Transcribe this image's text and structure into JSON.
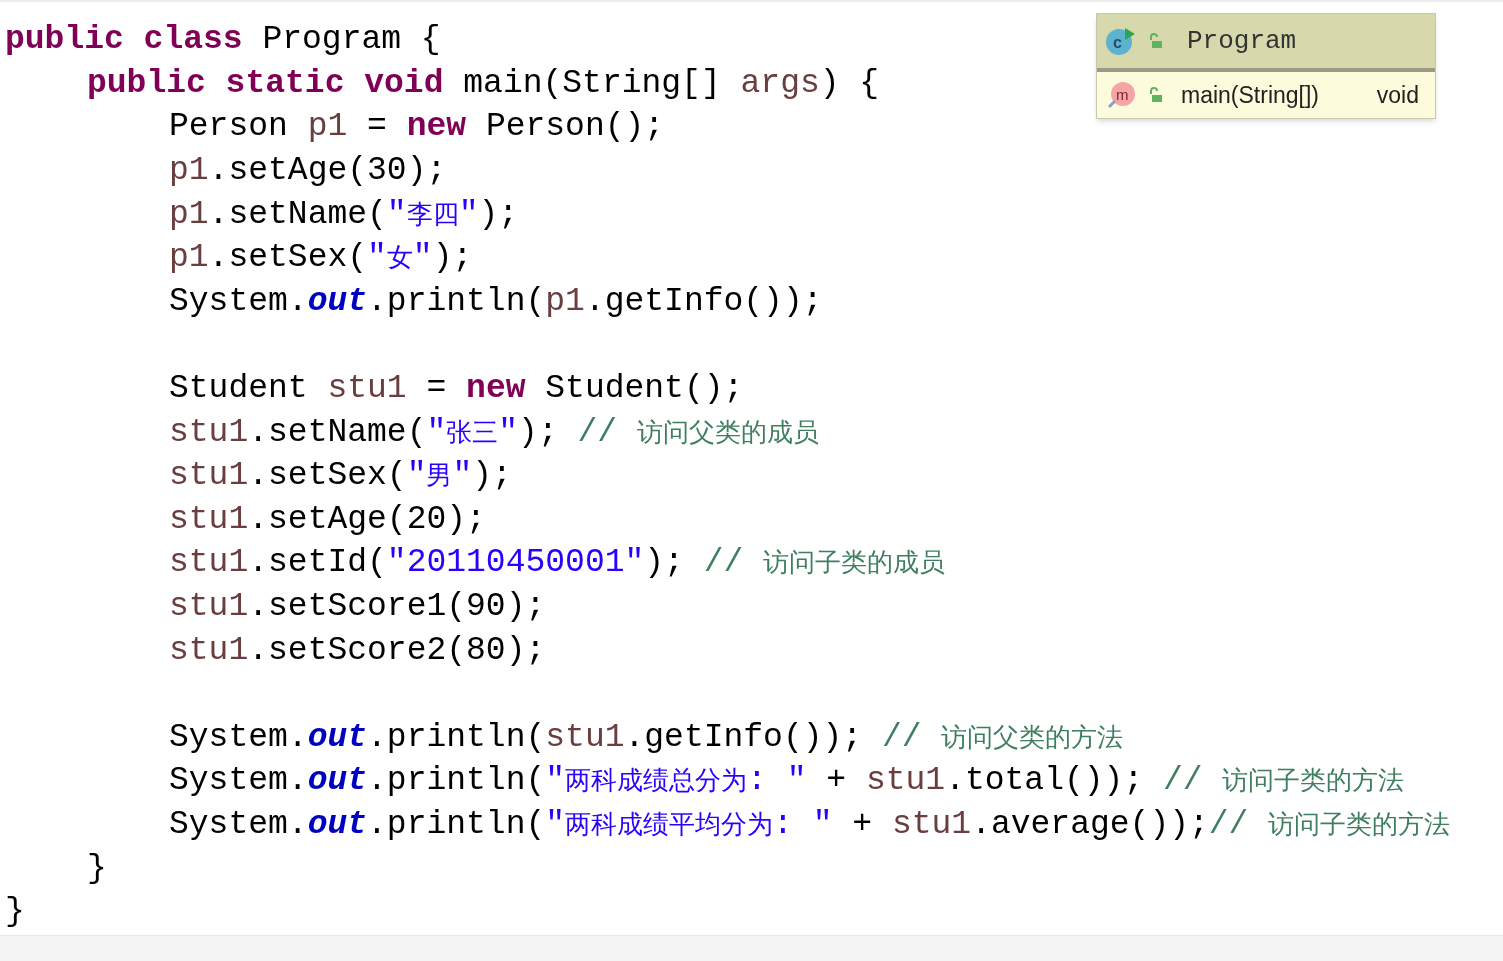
{
  "code": [
    {
      "kind": "code",
      "tokens": [
        {
          "kind": "kw",
          "text": "public class"
        },
        {
          "kind": "plain",
          "text": " Program {"
        }
      ],
      "children": [
        {
          "kind": "code",
          "tokens": [
            {
              "kind": "kw",
              "text": "public static void"
            },
            {
              "kind": "plain",
              "text": " main(String[] "
            },
            {
              "kind": "var",
              "text": "args"
            },
            {
              "kind": "plain",
              "text": ") {"
            }
          ],
          "children": [
            {
              "kind": "code",
              "tokens": [
                {
                  "kind": "plain",
                  "text": "Person "
                },
                {
                  "kind": "var",
                  "text": "p1"
                },
                {
                  "kind": "plain",
                  "text": " = "
                },
                {
                  "kind": "kw",
                  "text": "new"
                },
                {
                  "kind": "plain",
                  "text": " Person();"
                }
              ]
            },
            {
              "kind": "code",
              "tokens": [
                {
                  "kind": "var",
                  "text": "p1"
                },
                {
                  "kind": "plain",
                  "text": ".setAge(30);"
                }
              ]
            },
            {
              "kind": "code",
              "tokens": [
                {
                  "kind": "var",
                  "text": "p1"
                },
                {
                  "kind": "plain",
                  "text": ".setName("
                },
                {
                  "kind": "str",
                  "text": "\"李四\""
                },
                {
                  "kind": "plain",
                  "text": ");"
                }
              ]
            },
            {
              "kind": "code",
              "tokens": [
                {
                  "kind": "var",
                  "text": "p1"
                },
                {
                  "kind": "plain",
                  "text": ".setSex("
                },
                {
                  "kind": "str",
                  "text": "\"女\""
                },
                {
                  "kind": "plain",
                  "text": ");"
                }
              ]
            },
            {
              "kind": "code",
              "tokens": [
                {
                  "kind": "plain",
                  "text": "System."
                },
                {
                  "kind": "field",
                  "text": "out"
                },
                {
                  "kind": "plain",
                  "text": ".println("
                },
                {
                  "kind": "var",
                  "text": "p1"
                },
                {
                  "kind": "plain",
                  "text": ".getInfo());"
                }
              ]
            },
            {
              "kind": "blank"
            },
            {
              "kind": "code",
              "tokens": [
                {
                  "kind": "plain",
                  "text": "Student "
                },
                {
                  "kind": "var",
                  "text": "stu1"
                },
                {
                  "kind": "plain",
                  "text": " = "
                },
                {
                  "kind": "kw",
                  "text": "new"
                },
                {
                  "kind": "plain",
                  "text": " Student();"
                }
              ]
            },
            {
              "kind": "code",
              "tokens": [
                {
                  "kind": "var",
                  "text": "stu1"
                },
                {
                  "kind": "plain",
                  "text": ".setName("
                },
                {
                  "kind": "str",
                  "text": "\"张三\""
                },
                {
                  "kind": "plain",
                  "text": "); "
                },
                {
                  "kind": "com",
                  "text": "// 访问父类的成员"
                }
              ]
            },
            {
              "kind": "code",
              "tokens": [
                {
                  "kind": "var",
                  "text": "stu1"
                },
                {
                  "kind": "plain",
                  "text": ".setSex("
                },
                {
                  "kind": "str",
                  "text": "\"男\""
                },
                {
                  "kind": "plain",
                  "text": ");"
                }
              ]
            },
            {
              "kind": "code",
              "tokens": [
                {
                  "kind": "var",
                  "text": "stu1"
                },
                {
                  "kind": "plain",
                  "text": ".setAge(20);"
                }
              ]
            },
            {
              "kind": "code",
              "tokens": [
                {
                  "kind": "var",
                  "text": "stu1"
                },
                {
                  "kind": "plain",
                  "text": ".setId("
                },
                {
                  "kind": "str",
                  "text": "\"20110450001\""
                },
                {
                  "kind": "plain",
                  "text": "); "
                },
                {
                  "kind": "com",
                  "text": "// 访问子类的成员"
                }
              ]
            },
            {
              "kind": "code",
              "tokens": [
                {
                  "kind": "var",
                  "text": "stu1"
                },
                {
                  "kind": "plain",
                  "text": ".setScore1(90);"
                }
              ]
            },
            {
              "kind": "code",
              "tokens": [
                {
                  "kind": "var",
                  "text": "stu1"
                },
                {
                  "kind": "plain",
                  "text": ".setScore2(80);"
                }
              ]
            },
            {
              "kind": "blank"
            },
            {
              "kind": "code",
              "tokens": [
                {
                  "kind": "plain",
                  "text": "System."
                },
                {
                  "kind": "field",
                  "text": "out"
                },
                {
                  "kind": "plain",
                  "text": ".println("
                },
                {
                  "kind": "var",
                  "text": "stu1"
                },
                {
                  "kind": "plain",
                  "text": ".getInfo()); "
                },
                {
                  "kind": "com",
                  "text": "// 访问父类的方法"
                }
              ]
            },
            {
              "kind": "code",
              "tokens": [
                {
                  "kind": "plain",
                  "text": "System."
                },
                {
                  "kind": "field",
                  "text": "out"
                },
                {
                  "kind": "plain",
                  "text": ".println("
                },
                {
                  "kind": "str",
                  "text": "\"两科成绩总分为: \""
                },
                {
                  "kind": "plain",
                  "text": " + "
                },
                {
                  "kind": "var",
                  "text": "stu1"
                },
                {
                  "kind": "plain",
                  "text": ".total()); "
                },
                {
                  "kind": "com",
                  "text": "// 访问子类的方法"
                }
              ]
            },
            {
              "kind": "code",
              "tokens": [
                {
                  "kind": "plain",
                  "text": "System."
                },
                {
                  "kind": "field",
                  "text": "out"
                },
                {
                  "kind": "plain",
                  "text": ".println("
                },
                {
                  "kind": "str",
                  "text": "\"两科成绩平均分为: \""
                },
                {
                  "kind": "plain",
                  "text": " + "
                },
                {
                  "kind": "var",
                  "text": "stu1"
                },
                {
                  "kind": "plain",
                  "text": ".average());"
                },
                {
                  "kind": "com",
                  "text": "// 访问子类的方法"
                }
              ]
            }
          ]
        },
        {
          "kind": "code",
          "tokens": [
            {
              "kind": "plain",
              "text": "}"
            }
          ]
        }
      ]
    },
    {
      "kind": "code",
      "tokens": [
        {
          "kind": "plain",
          "text": "}"
        }
      ]
    }
  ],
  "outline": {
    "icon_letter": "c",
    "title": "Program",
    "members": [
      {
        "icon_letter": "m",
        "signature": "main(String[])",
        "return_type": "void"
      }
    ]
  }
}
